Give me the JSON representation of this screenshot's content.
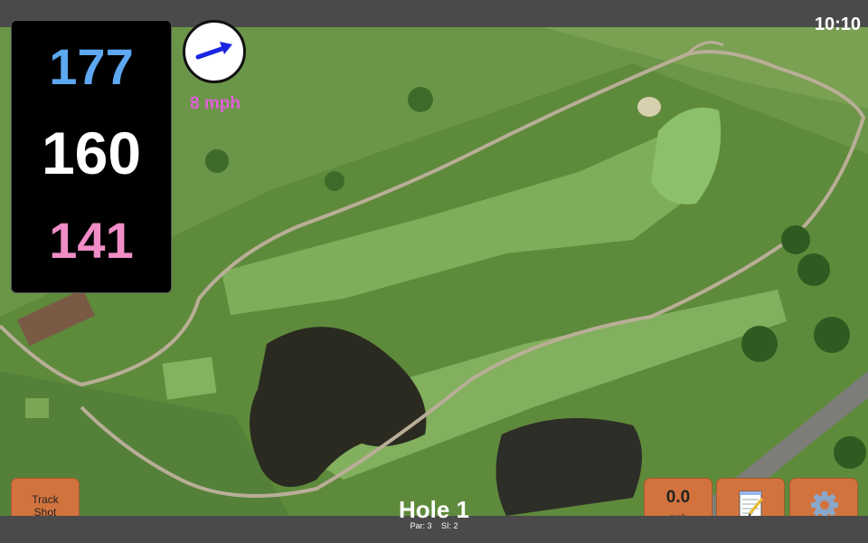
{
  "status": {
    "time": "10:10"
  },
  "yardage": {
    "back": "177",
    "center": "160",
    "front": "141",
    "colors": {
      "back": "#5da8f0",
      "center": "#ffffff",
      "front": "#f08cc6"
    }
  },
  "wind": {
    "speed_label": "8 mph",
    "arrow_color": "#1a25e0",
    "label_color": "#e060d8",
    "direction_icon": "arrow-icon"
  },
  "buttons": {
    "track_shot": "Track\nShot",
    "wind_value": "0.0",
    "wind_unit": "mph",
    "notes_icon": "notepad-icon",
    "settings_icon": "gear-icon"
  },
  "hole": {
    "title": "Hole 1",
    "par": "Par: 3",
    "si": "SI: 2"
  }
}
